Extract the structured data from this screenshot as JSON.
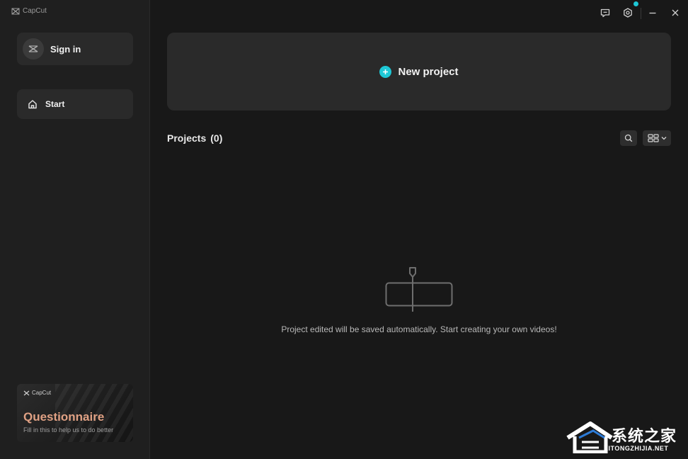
{
  "app": {
    "brand": "CapCut"
  },
  "sidebar": {
    "sign_in_label": "Sign in",
    "nav": [
      {
        "label": "Start",
        "icon": "home-icon"
      }
    ],
    "promo": {
      "brand": "CapCut",
      "title": "Questionnaire",
      "subtitle": "Fill in this to help us to do better"
    }
  },
  "topbar": {
    "icons": [
      "feedback-icon",
      "settings-icon",
      "minimize-icon",
      "close-icon"
    ],
    "settings_badge_color": "#1ec8d6"
  },
  "main": {
    "new_project_label": "New project",
    "projects_title": "Projects",
    "projects_count": "(0)",
    "empty_message": "Project edited will be saved automatically. Start creating your own videos!"
  },
  "watermark": {
    "text_cn": "系统之家",
    "url": "XITONGZHIJIA.NET"
  },
  "colors": {
    "accent": "#1ec8d6",
    "background": "#181818",
    "panel": "#2a2a2a",
    "promo_title": "#e0a184"
  }
}
